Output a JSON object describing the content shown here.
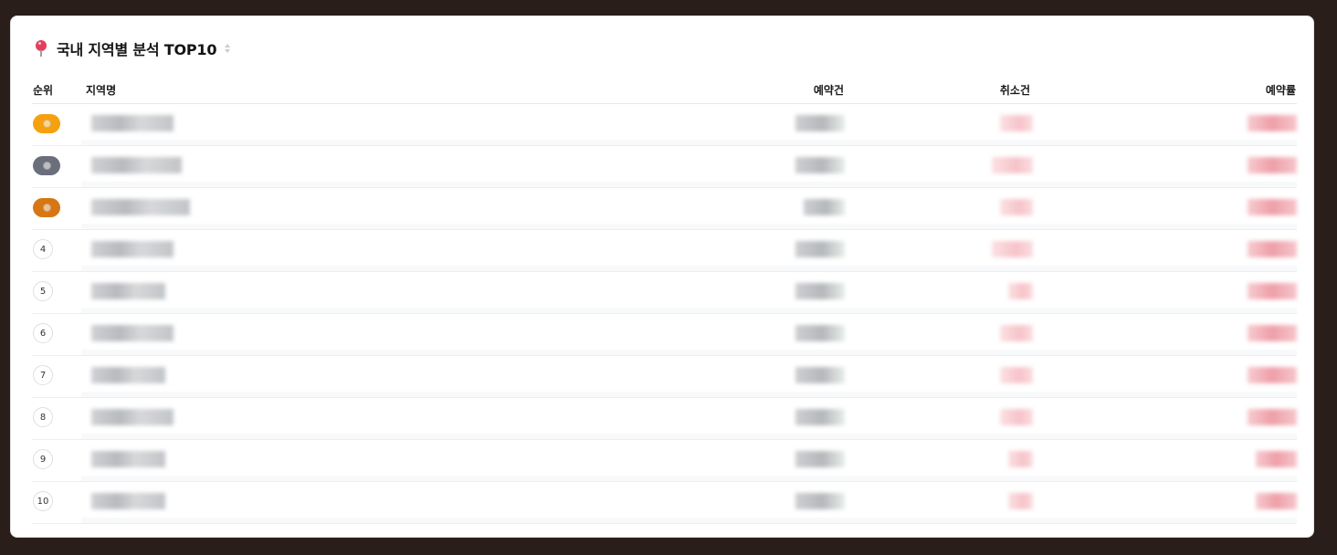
{
  "section": {
    "title": "국내 지역별 분석 TOP10",
    "icon": "map-pin-icon",
    "sort_icon": "sort-icon"
  },
  "columns": {
    "rank": "순위",
    "name": "지역명",
    "reservations": "예약건",
    "cancellations": "취소건",
    "rate": "예약률"
  },
  "rows": [
    {
      "rank": "1",
      "badge": "gold",
      "name": "",
      "reservations": "",
      "cancellations": "",
      "rate": ""
    },
    {
      "rank": "2",
      "badge": "silver",
      "name": "",
      "reservations": "",
      "cancellations": "",
      "rate": ""
    },
    {
      "rank": "3",
      "badge": "bronze",
      "name": "",
      "reservations": "",
      "cancellations": "",
      "rate": ""
    },
    {
      "rank": "4",
      "badge": "",
      "name": "",
      "reservations": "",
      "cancellations": "",
      "rate": ""
    },
    {
      "rank": "5",
      "badge": "",
      "name": "",
      "reservations": "",
      "cancellations": "",
      "rate": ""
    },
    {
      "rank": "6",
      "badge": "",
      "name": "",
      "reservations": "",
      "cancellations": "",
      "rate": ""
    },
    {
      "rank": "7",
      "badge": "",
      "name": "",
      "reservations": "",
      "cancellations": "",
      "rate": ""
    },
    {
      "rank": "8",
      "badge": "",
      "name": "",
      "reservations": "",
      "cancellations": "",
      "rate": ""
    },
    {
      "rank": "9",
      "badge": "",
      "name": "",
      "reservations": "",
      "cancellations": "",
      "rate": ""
    },
    {
      "rank": "10",
      "badge": "",
      "name": "",
      "reservations": "",
      "cancellations": "",
      "rate": ""
    }
  ],
  "colors": {
    "gold": "#f5a00f",
    "silver": "#6b6f7b",
    "bronze": "#d77713",
    "cancel_tint": "#f6c3c9",
    "rate_tint": "#ee9fa8"
  }
}
